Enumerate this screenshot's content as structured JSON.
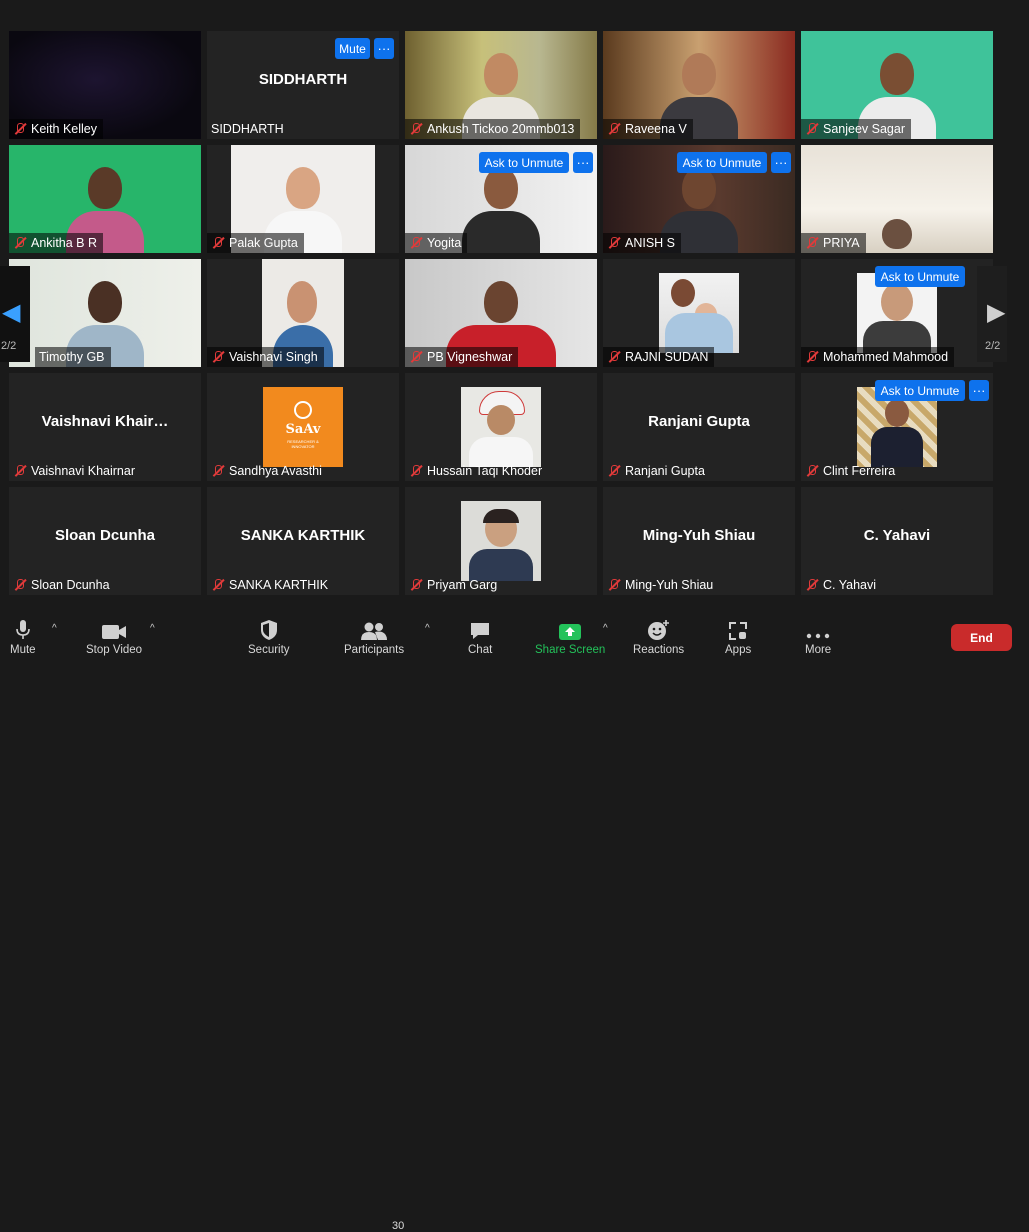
{
  "tiles": [
    {
      "name": "Keith Kelley",
      "big": ""
    },
    {
      "name": "SIDDHARTH",
      "big": "SIDDHARTH",
      "button": "Mute"
    },
    {
      "name": "Ankush Tickoo 20mmb013",
      "big": ""
    },
    {
      "name": "Raveena V",
      "big": ""
    },
    {
      "name": "Sanjeev Sagar",
      "big": ""
    },
    {
      "name": "Ankitha B R",
      "big": ""
    },
    {
      "name": "Palak Gupta",
      "big": ""
    },
    {
      "name": "Yogita",
      "big": "",
      "button": "Ask to Unmute"
    },
    {
      "name": "ANISH S",
      "big": "",
      "button": "Ask to Unmute"
    },
    {
      "name": "PRIYA",
      "big": ""
    },
    {
      "name": "Timothy GB",
      "big": ""
    },
    {
      "name": "Vaishnavi Singh",
      "big": ""
    },
    {
      "name": "PB Vigneshwar",
      "big": ""
    },
    {
      "name": "RAJNI SUDAN",
      "big": ""
    },
    {
      "name": "Mohammed Mahmood",
      "big": "",
      "button": "Ask to Unmute"
    },
    {
      "name": "Vaishnavi Khairnar",
      "big": "Vaishnavi  Khair…"
    },
    {
      "name": "Sandhya Avasthi",
      "big": ""
    },
    {
      "name": "Hussain Taqi Khoder",
      "big": ""
    },
    {
      "name": "Ranjani Gupta",
      "big": "Ranjani Gupta"
    },
    {
      "name": "Clint Ferreira",
      "big": "",
      "button": "Ask to Unmute"
    },
    {
      "name": "Sloan Dcunha",
      "big": "Sloan Dcunha"
    },
    {
      "name": "SANKA KARTHIK",
      "big": "SANKA KARTHIK"
    },
    {
      "name": "Priyam Garg",
      "big": ""
    },
    {
      "name": "Ming-Yuh Shiau",
      "big": "Ming-Yuh Shiau"
    },
    {
      "name": "C. Yahavi",
      "big": "C. Yahavi"
    }
  ],
  "more_button": "···",
  "saav_logo": {
    "title": "SaAv",
    "subtitle": "RESEARCHER & INNOVATOR"
  },
  "pagination": {
    "left": "2/2",
    "right": "2/2"
  },
  "toolbar": {
    "mute": "Mute",
    "stop_video": "Stop Video",
    "security": "Security",
    "participants": "Participants",
    "participants_count": "30",
    "chat": "Chat",
    "share_screen": "Share Screen",
    "reactions": "Reactions",
    "apps": "Apps",
    "more": "More",
    "end": "End"
  },
  "colors": {
    "accent_blue": "#0e72ed",
    "share_green": "#23c25a",
    "end_red": "#c92b2b",
    "muted_red": "#e03a3a"
  }
}
